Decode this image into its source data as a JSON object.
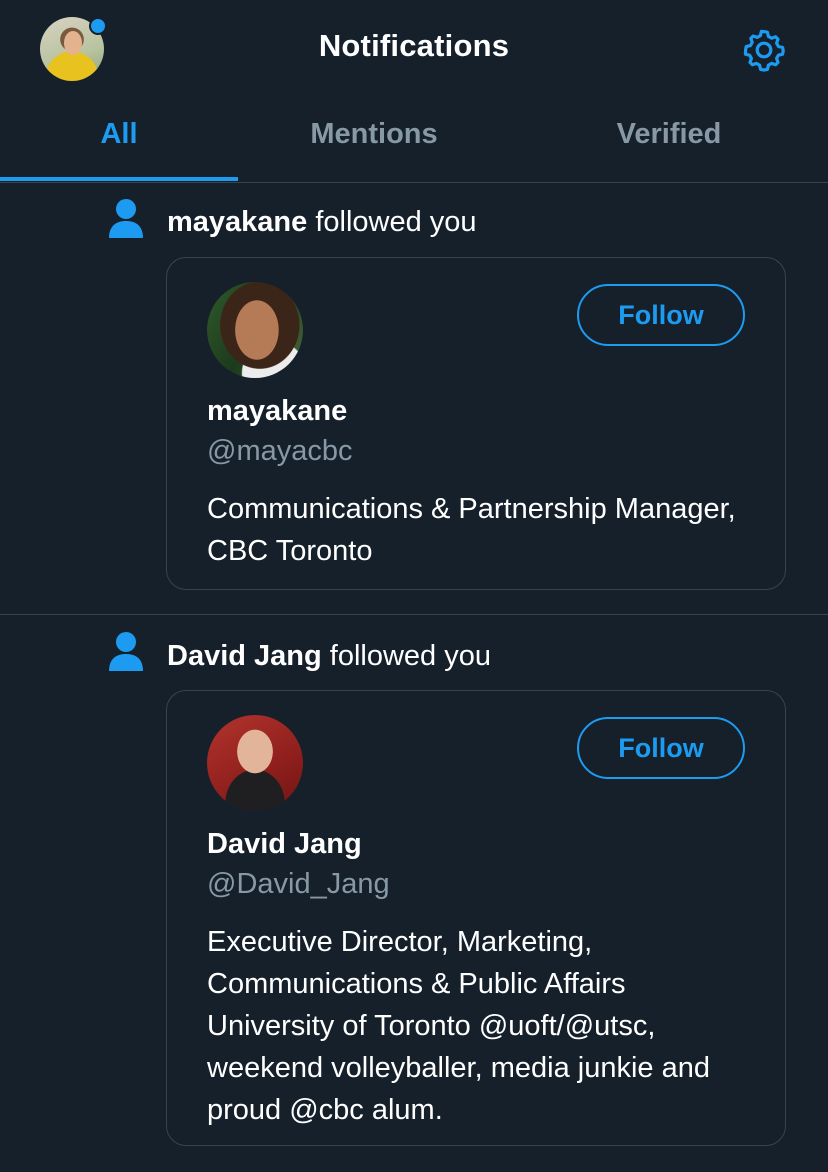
{
  "header": {
    "title": "Notifications",
    "icons": {
      "avatar": "profile-avatar",
      "settings": "gear-icon"
    },
    "has_unread_dot": true
  },
  "tabs": [
    {
      "label": "All",
      "active": true
    },
    {
      "label": "Mentions",
      "active": false
    },
    {
      "label": "Verified",
      "active": false
    }
  ],
  "notifications": [
    {
      "icon": "person-icon",
      "actor": "mayakane",
      "action": " followed you",
      "card": {
        "follow_label": "Follow",
        "name": "mayakane",
        "handle": "@mayacbc",
        "bio": "Communications & Partnership Manager, CBC Toronto"
      }
    },
    {
      "icon": "person-icon",
      "actor": "David Jang",
      "action": " followed you",
      "card": {
        "follow_label": "Follow",
        "name": "David Jang",
        "handle": "@David_Jang",
        "bio": "Executive Director, Marketing, Communications & Public Affairs University of Toronto @uoft/@utsc, weekend volleyballer, media junkie and proud @cbc alum."
      }
    }
  ],
  "colors": {
    "background": "#15202b",
    "accent": "#1d9bf0",
    "secondary_text": "#8899a6",
    "divider": "#38444d"
  }
}
